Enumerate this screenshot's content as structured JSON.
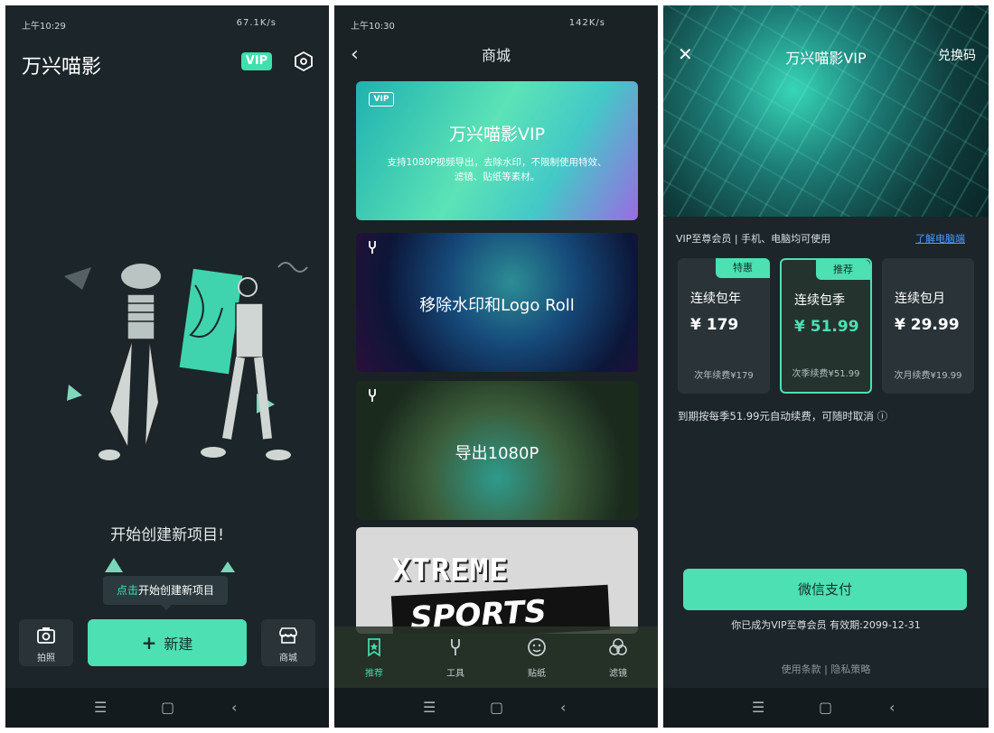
{
  "panel1": {
    "status_time": "上午10:29",
    "status_right": "67.1K/s",
    "title": "万兴喵影",
    "vip_badge": "VIP",
    "create_text": "开始创建新项目!",
    "tooltip_highlight": "点击",
    "tooltip_text": "开始创建新项目",
    "camera_label": "拍照",
    "new_label": "新建",
    "store_label": "商城"
  },
  "panel2": {
    "status_time": "上午10:30",
    "status_right": "142K/s",
    "title": "商城",
    "vip_card": {
      "tag": "VIP",
      "title": "万兴喵影VIP",
      "desc": "支持1080P视频导出，去除水印，不限制使用特效、滤镜、贴纸等素材。"
    },
    "card_watermark": "移除水印和Logo Roll",
    "card_export": "导出1080P",
    "card_sports_line1": "XTREME",
    "card_sports_line2": "SPORTS",
    "tabs": [
      {
        "label": "推荐"
      },
      {
        "label": "工具"
      },
      {
        "label": "贴纸"
      },
      {
        "label": "滤镜"
      }
    ]
  },
  "panel3": {
    "title": "万兴喵影VIP",
    "redeem": "兑换码",
    "subtitle": "VIP至尊会员 | 手机、电脑均可使用",
    "learn_link": "了解电脑端",
    "plans": [
      {
        "tag": "特惠",
        "name": "连续包年",
        "price": "¥ 179",
        "renew": "次年续费¥179"
      },
      {
        "tag": "推荐",
        "name": "连续包季",
        "price": "¥ 51.99",
        "renew": "次季续费¥51.99"
      },
      {
        "name": "连续包月",
        "price": "¥ 29.99",
        "renew": "次月续费¥19.99"
      }
    ],
    "note": "到期按每季51.99元自动续费，可随时取消 ⓘ",
    "pay_button": "微信支付",
    "member_text": "你已成为VIP至尊会员 有效期:2099-12-31",
    "terms": "使用条款 | 隐私策略"
  },
  "nav": {
    "menu": "☰",
    "home": "▢",
    "back": "‹"
  },
  "colors": {
    "accent": "#4ce0b3",
    "background": "#1c2529"
  }
}
